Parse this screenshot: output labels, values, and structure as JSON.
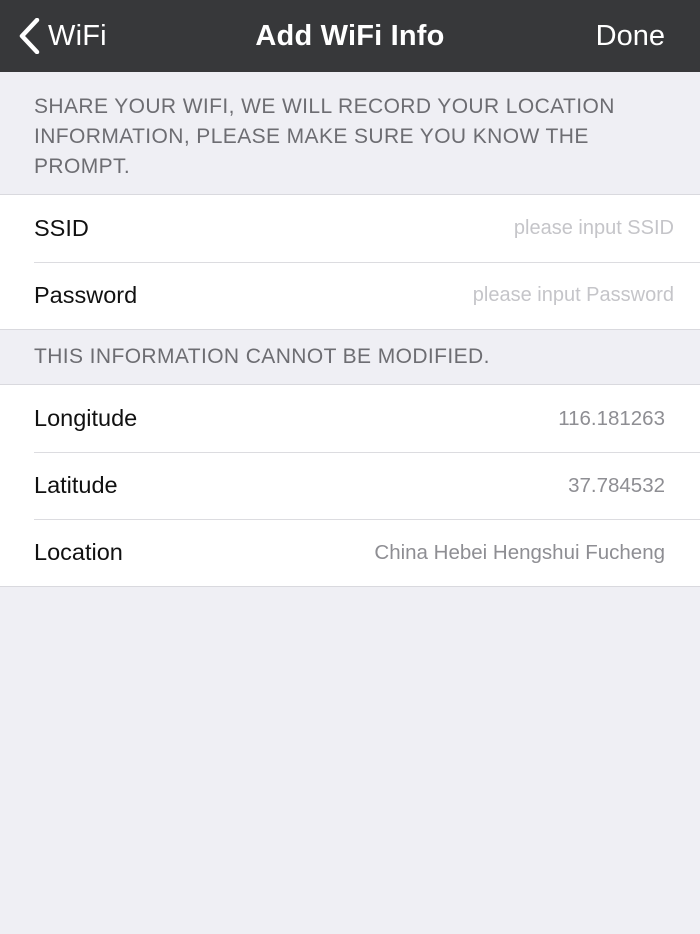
{
  "nav": {
    "back_label": "WiFi",
    "title": "Add WiFi Info",
    "done_label": "Done"
  },
  "share_section": {
    "header": "SHARE YOUR WIFI, WE WILL RECORD YOUR LOCATION INFORMATION, PLEASE MAKE SURE YOU KNOW THE PROMPT.",
    "ssid": {
      "label": "SSID",
      "value": "",
      "placeholder": "please input SSID"
    },
    "password": {
      "label": "Password",
      "value": "",
      "placeholder": "please input Password"
    }
  },
  "location_section": {
    "header": "THIS INFORMATION CANNOT BE MODIFIED.",
    "longitude": {
      "label": "Longitude",
      "value": "116.181263"
    },
    "latitude": {
      "label": "Latitude",
      "value": "37.784532"
    },
    "location": {
      "label": "Location",
      "value": "China Hebei Hengshui Fucheng"
    }
  },
  "theme": {
    "navbar_bg": "#37383a",
    "page_bg": "#efeff4",
    "placeholder_color": "#c5c5c9",
    "value_color": "#8e8e93"
  },
  "icons": {
    "back": "chevron-left-icon"
  }
}
